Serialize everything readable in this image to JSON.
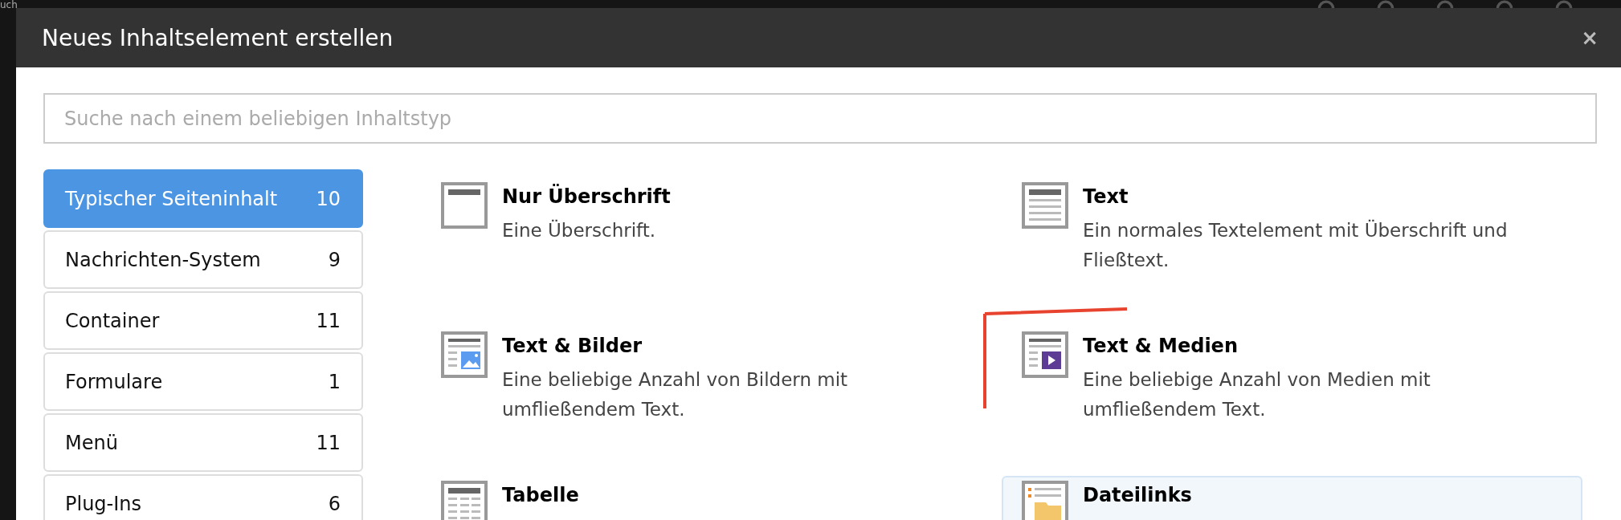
{
  "backdrop": {
    "text": "uch"
  },
  "dialog": {
    "title": "Neues Inhaltselement erstellen",
    "close": "×"
  },
  "search": {
    "placeholder": "Suche nach einem beliebigen Inhaltstyp"
  },
  "categories": [
    {
      "label": "Typischer Seiteninhalt",
      "count": "10",
      "selected": true
    },
    {
      "label": "Nachrichten-System",
      "count": "9",
      "selected": false
    },
    {
      "label": "Container",
      "count": "11",
      "selected": false
    },
    {
      "label": "Formulare",
      "count": "1",
      "selected": false
    },
    {
      "label": "Menü",
      "count": "11",
      "selected": false
    },
    {
      "label": "Plug-Ins",
      "count": "6",
      "selected": false
    }
  ],
  "elements": [
    {
      "kind": "header",
      "title": "Nur Überschrift",
      "description": "Eine Überschrift.",
      "selected": false,
      "marked": false
    },
    {
      "kind": "text",
      "title": "Text",
      "description": "Ein normales Textelement mit Überschrift und Fließtext.",
      "selected": false,
      "marked": false
    },
    {
      "kind": "textpic",
      "title": "Text & Bilder",
      "description": "Eine beliebige Anzahl von Bildern mit umfließendem Text.",
      "selected": false,
      "marked": false
    },
    {
      "kind": "textmedia",
      "title": "Text & Medien",
      "description": "Eine beliebige Anzahl von Medien mit umfließendem Text.",
      "selected": false,
      "marked": true
    },
    {
      "kind": "table",
      "title": "Tabelle",
      "selected": false,
      "marked": false
    },
    {
      "kind": "uploads",
      "title": "Dateilinks",
      "selected": true,
      "marked": false
    }
  ]
}
